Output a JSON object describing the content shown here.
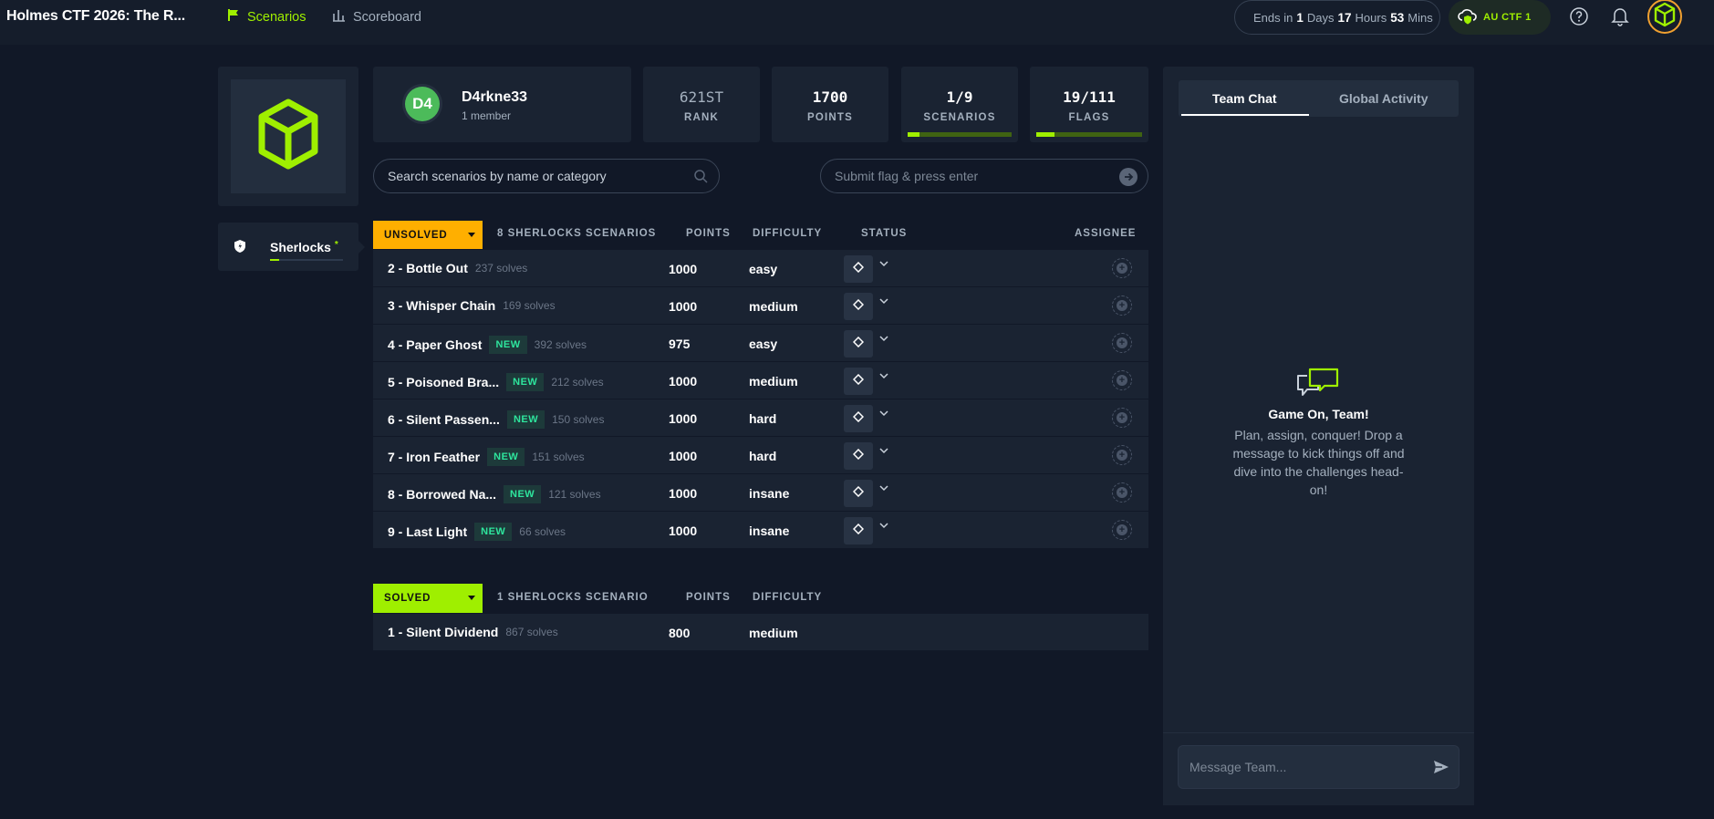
{
  "header": {
    "app_title": "Holmes CTF 2026: The R...",
    "nav": [
      {
        "label": "Scenarios"
      },
      {
        "label": "Scoreboard"
      }
    ],
    "timer": {
      "prefix": "Ends in",
      "days": "1",
      "days_label": "Days",
      "hours": "17",
      "hours_label": "Hours",
      "mins": "53",
      "mins_label": "Mins"
    },
    "vpn": {
      "label": "AU CTF 1"
    }
  },
  "sidebar": {
    "tab_label": "Sherlocks",
    "tab_marker": "*"
  },
  "team": {
    "initials": "D4",
    "name": "D4rkne33",
    "members": "1 member"
  },
  "stats": [
    {
      "value": "621ST",
      "label": "RANK"
    },
    {
      "value": "1700",
      "label": "POINTS"
    },
    {
      "value": "1/9",
      "label": "SCENARIOS",
      "progress": 0.11
    },
    {
      "value": "19/111",
      "label": "FLAGS",
      "progress": 0.17
    }
  ],
  "search": {
    "placeholder": "Search scenarios by name or category"
  },
  "flag_input": {
    "placeholder": "Submit flag & press enter"
  },
  "unsolved": {
    "filter_label": "UNSOLVED",
    "count_label": "8 SHERLOCKS SCENARIOS",
    "columns": {
      "points": "POINTS",
      "difficulty": "DIFFICULTY",
      "status": "STATUS",
      "assignee": "ASSIGNEE"
    },
    "rows": [
      {
        "name": "2 - Bottle Out",
        "new": "",
        "solves": "237 solves",
        "points": "1000",
        "difficulty": "easy"
      },
      {
        "name": "3 - Whisper Chain",
        "new": "",
        "solves": "169 solves",
        "points": "1000",
        "difficulty": "medium"
      },
      {
        "name": "4 - Paper Ghost",
        "new": "NEW",
        "solves": "392 solves",
        "points": "975",
        "difficulty": "easy"
      },
      {
        "name": "5 - Poisoned Bra...",
        "new": "NEW",
        "solves": "212 solves",
        "points": "1000",
        "difficulty": "medium"
      },
      {
        "name": "6 - Silent Passen...",
        "new": "NEW",
        "solves": "150 solves",
        "points": "1000",
        "difficulty": "hard"
      },
      {
        "name": "7 - Iron Feather",
        "new": "NEW",
        "solves": "151 solves",
        "points": "1000",
        "difficulty": "hard"
      },
      {
        "name": "8 - Borrowed Na...",
        "new": "NEW",
        "solves": "121 solves",
        "points": "1000",
        "difficulty": "insane"
      },
      {
        "name": "9 - Last Light",
        "new": "NEW",
        "solves": "66 solves",
        "points": "1000",
        "difficulty": "insane"
      }
    ]
  },
  "solved": {
    "filter_label": "SOLVED",
    "count_label": "1 SHERLOCKS SCENARIO",
    "columns": {
      "points": "POINTS",
      "difficulty": "DIFFICULTY"
    },
    "rows": [
      {
        "name": "1 - Silent Dividend",
        "solves": "867 solves",
        "points": "800",
        "difficulty": "medium"
      }
    ]
  },
  "chat": {
    "tabs": [
      {
        "label": "Team Chat"
      },
      {
        "label": "Global Activity"
      }
    ],
    "empty_title": "Game On, Team!",
    "empty_body": "Plan, assign, conquer! Drop a message to kick things off and dive into the challenges head-on!",
    "input_placeholder": "Message Team..."
  },
  "colors": {
    "accent": "#9fef00",
    "unsolved": "#ffaf00",
    "new_badge": "#2ee59d",
    "bg": "#111827",
    "panel": "#1a2332"
  },
  "icons": [
    "flag-icon",
    "bar-chart-icon",
    "cloud-shield-icon",
    "help-icon",
    "bell-icon",
    "cube-logo-icon",
    "sherlock-shield-icon",
    "search-icon",
    "arrow-right-icon",
    "diamond-icon",
    "chevron-down-icon",
    "add-assignee-icon",
    "chat-bubbles-icon",
    "send-icon"
  ]
}
